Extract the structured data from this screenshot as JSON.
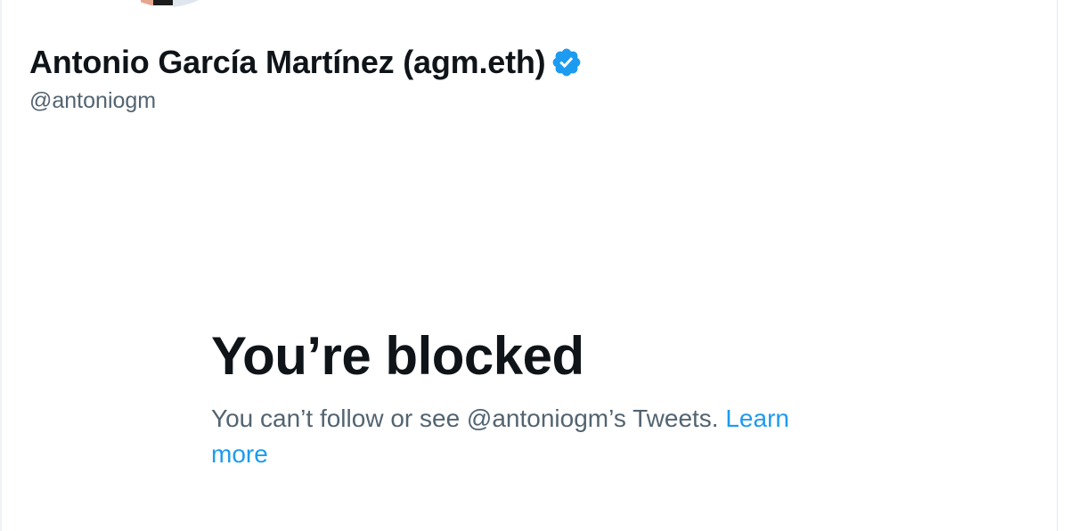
{
  "profile": {
    "display_name": "Antonio García Martínez (agm.eth)",
    "handle": "@antoniogm",
    "verified_icon": "verified-badge-icon"
  },
  "blocked": {
    "title": "You’re blocked",
    "message": "You can’t follow or see @antoniogm’s Tweets.",
    "learn_more_label": "Learn more"
  },
  "colors": {
    "primary_text": "#0f1419",
    "secondary_text": "#536471",
    "link": "#1d9bf0",
    "verified": "#1d9bf0"
  }
}
